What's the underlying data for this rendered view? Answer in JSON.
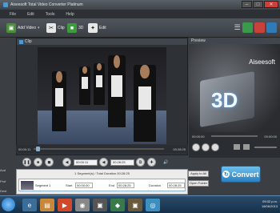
{
  "window": {
    "title": "Aiseesoft Total Video Converter Platinum"
  },
  "menu": [
    "File",
    "Edit",
    "Tools",
    "Help"
  ],
  "toolbar": {
    "add_video": "Add Video",
    "clip": "Clip",
    "three_d": "3D",
    "edit": "Edit"
  },
  "clip_window": {
    "title": "Clip",
    "time_start": "00:00:11",
    "time_end": "00:28:25",
    "start_field": "00:00:11",
    "end_field": "00:28:25",
    "segment_total": "1 Segment(s) / Total Duration 00:28:25",
    "segment_label": "Segment 1",
    "start_label": "Start",
    "start_value": "00:00:00",
    "end_label": "End",
    "end_value": "00:28:25",
    "duration_label": "Duration",
    "duration_value": "00:28:25"
  },
  "preview": {
    "title": "Preview",
    "logo": "Aiseesoft",
    "three_d_text": "3D",
    "time_start": "00:00:00",
    "time_end": "00:00:00"
  },
  "side": {
    "apply_all": "Apply to All",
    "open_folder": "Open Folder",
    "left_a": "Aud",
    "left_b": "Prof",
    "left_c": "Dest"
  },
  "convert": "Convert",
  "tray": {
    "time": "09:32 p.m.",
    "date": "18/06/2013"
  },
  "colors": {
    "accent": "#2b7fbf",
    "toolbar": "#3a3f45",
    "convert": "#4aa3db"
  }
}
